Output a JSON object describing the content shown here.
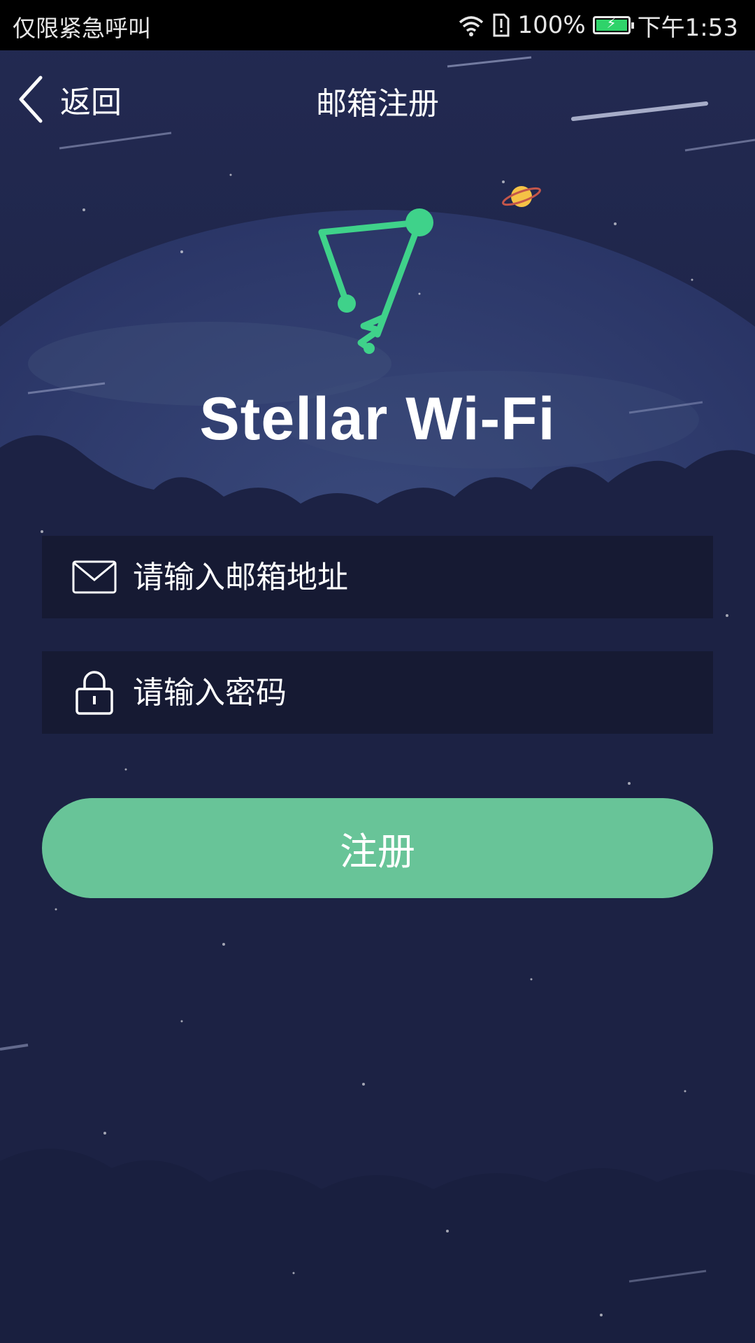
{
  "status_bar": {
    "carrier": "仅限紧急呼叫",
    "battery": "100%",
    "time": "下午1:53"
  },
  "header": {
    "back_label": "返回",
    "title": "邮箱注册"
  },
  "app": {
    "name": "Stellar Wi-Fi"
  },
  "form": {
    "email_placeholder": "请输入邮箱地址",
    "password_placeholder": "请输入密码",
    "register_label": "注册"
  },
  "colors": {
    "accent": "#68c498",
    "logo": "#3fd28a",
    "background": "#1e2549"
  },
  "icons": [
    "wifi-icon",
    "alert-sim-icon",
    "battery-icon",
    "back-chevron-icon",
    "envelope-icon",
    "lock-icon",
    "stellar-logo-icon",
    "planet-icon"
  ]
}
